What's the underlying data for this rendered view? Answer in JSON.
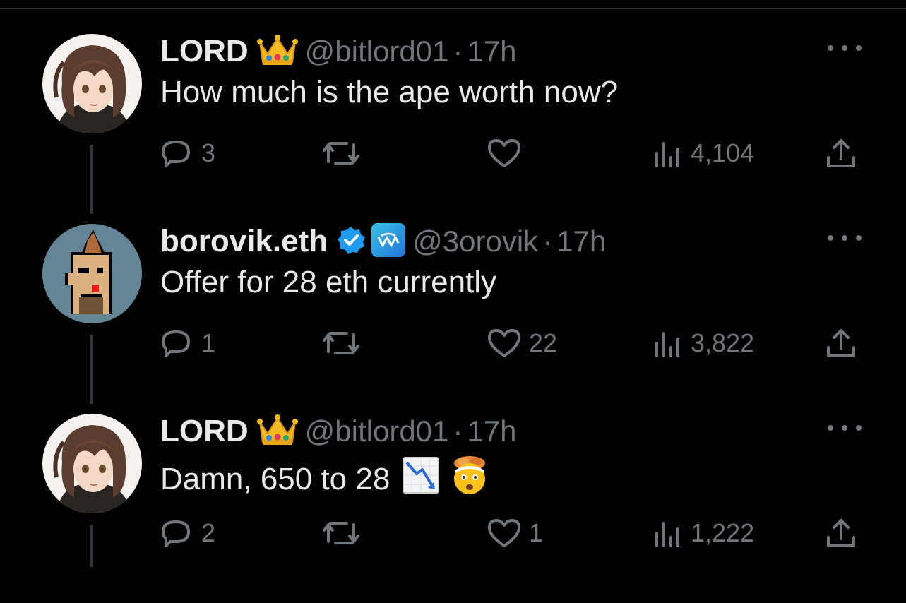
{
  "tweets": [
    {
      "name": "LORD",
      "name_emoji": "crown",
      "handle": "@bitlord01",
      "separator": "·",
      "time": "17h",
      "text": "How much is the ape worth now?",
      "replies": "3",
      "reposts": "",
      "likes": "",
      "views": "4,104"
    },
    {
      "name": "borovik.eth",
      "verified": true,
      "affiliate_badge": "blue-logo-badge",
      "handle": "@3orovik",
      "separator": "·",
      "time": "17h",
      "text": "Offer for 28 eth currently",
      "replies": "1",
      "reposts": "",
      "likes": "22",
      "views": "3,822"
    },
    {
      "name": "LORD",
      "name_emoji": "crown",
      "handle": "@bitlord01",
      "separator": "·",
      "time": "17h",
      "text": "Damn, 650 to 28",
      "text_emojis": [
        "chart-decreasing",
        "exploding-head"
      ],
      "replies": "2",
      "reposts": "",
      "likes": "1",
      "views": "1,222"
    }
  ],
  "colors": {
    "background": "#000000",
    "text": "#e7e9ea",
    "muted": "#71767b",
    "verified": "#1d9bf0",
    "thread_line": "#333639"
  }
}
